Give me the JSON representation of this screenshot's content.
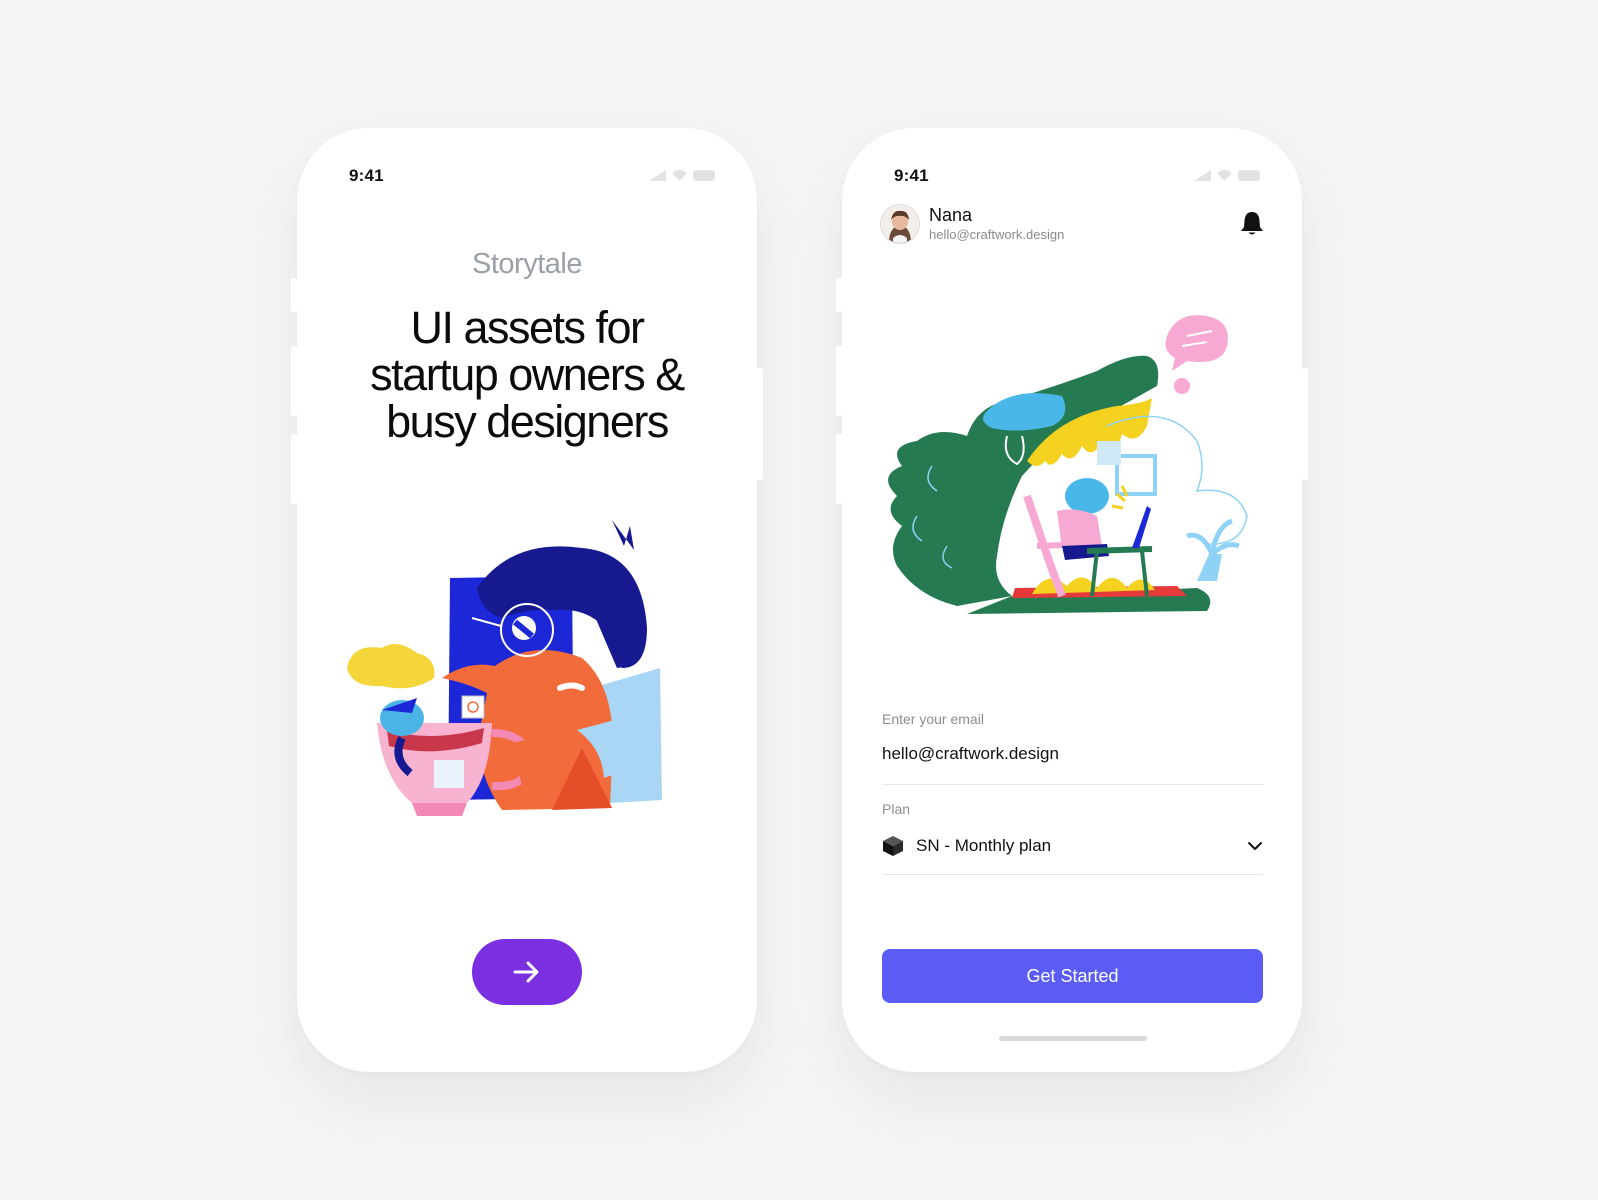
{
  "left_screen": {
    "status_time": "9:41",
    "brand": "Storytale",
    "headline_lines": [
      "UI assets for",
      "startup owners &",
      "busy designers"
    ],
    "illustration_icon": "designer-with-coffee-illustration",
    "next_button_icon": "arrow-right-icon"
  },
  "right_screen": {
    "status_time": "9:41",
    "user": {
      "name": "Nana",
      "email": "hello@craftwork.design",
      "avatar_icon": "avatar"
    },
    "bell_icon": "bell-icon",
    "illustration_icon": "crocodile-workspace-illustration",
    "email_field": {
      "label": "Enter your email",
      "value": "hello@craftwork.design"
    },
    "plan_field": {
      "label": "Plan",
      "value": "SN - Monthly plan",
      "icon": "cube-icon",
      "dropdown_icon": "chevron-down-icon"
    },
    "cta_label": "Get Started"
  },
  "colors": {
    "background": "#f4f4f4",
    "next_button": "#7b2fe0",
    "cta_button": "#5b5cf6",
    "brand_text": "#9aa0a6"
  }
}
